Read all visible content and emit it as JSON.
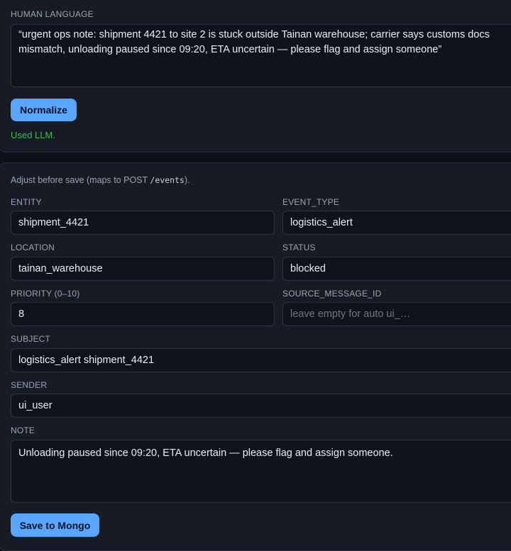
{
  "human_language": {
    "label": "HUMAN LANGUAGE",
    "text": "“urgent ops note: shipment 4421 to site 2 is stuck outside Tainan warehouse; carrier says customs docs mismatch, unloading paused since 09:20, ETA uncertain — please flag and assign someone”",
    "normalize_button": "Normalize",
    "status": "Used LLM."
  },
  "form": {
    "hint_prefix": "Adjust before save (maps to POST ",
    "hint_code": "/events",
    "hint_suffix": ").",
    "entity": {
      "label": "ENTITY",
      "value": "shipment_4421"
    },
    "event_type": {
      "label": "EVENT_TYPE",
      "value": "logistics_alert"
    },
    "location": {
      "label": "LOCATION",
      "value": "tainan_warehouse"
    },
    "status": {
      "label": "STATUS",
      "value": "blocked"
    },
    "priority": {
      "label": "PRIORITY (0–10)",
      "value": "8"
    },
    "source_message_id": {
      "label": "SOURCE_MESSAGE_ID",
      "value": "",
      "placeholder": "leave empty for auto ui_…"
    },
    "subject": {
      "label": "SUBJECT",
      "value": "logistics_alert shipment_4421"
    },
    "sender": {
      "label": "SENDER",
      "value": "ui_user"
    },
    "note": {
      "label": "NOTE",
      "value": "Unloading paused since 09:20, ETA uncertain — please flag and assign someone."
    },
    "save_button": "Save to Mongo"
  },
  "colors": {
    "background": "#0d1117",
    "card": "#161b26",
    "accent": "#58a6ff",
    "success": "#3fb950"
  }
}
